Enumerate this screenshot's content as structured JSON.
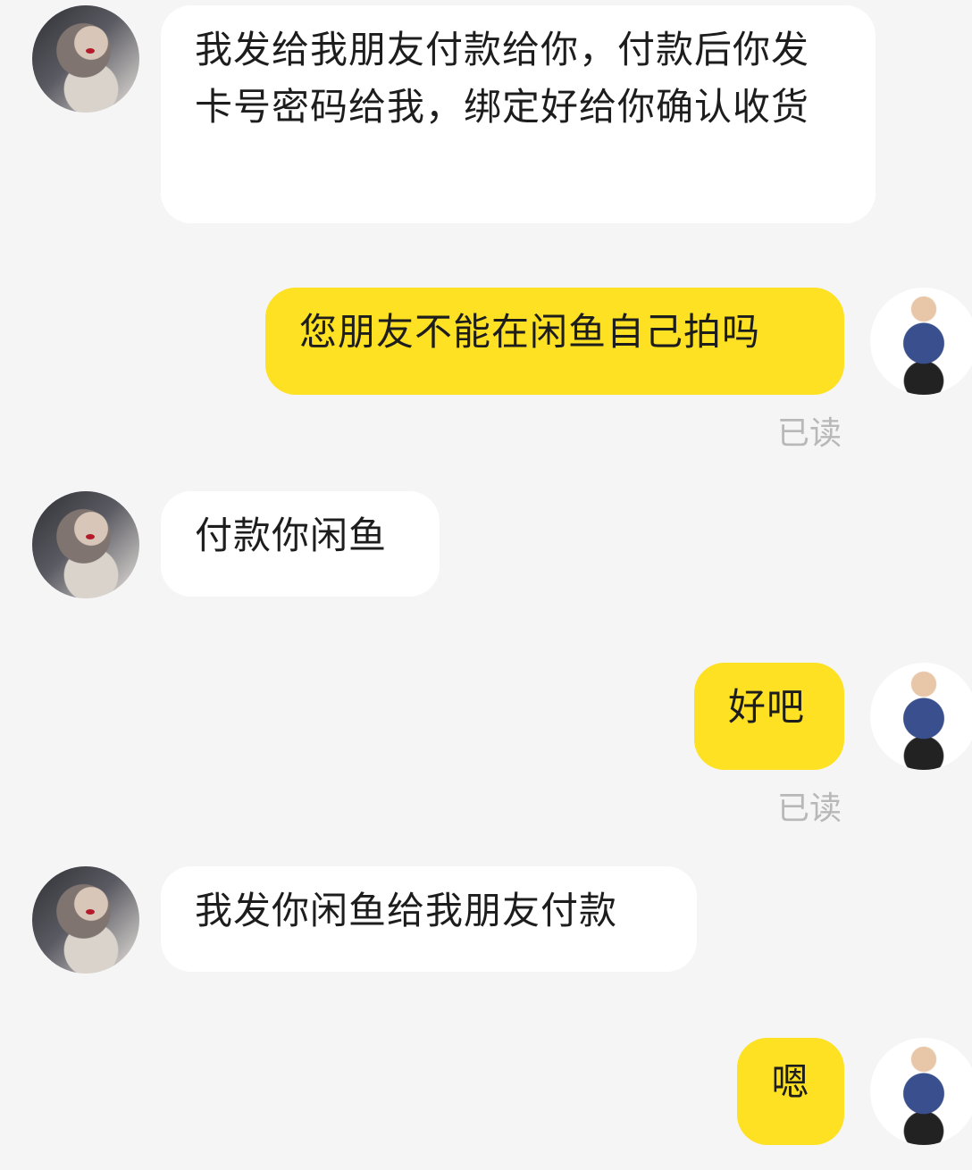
{
  "messages": [
    {
      "id": 1,
      "side": "left",
      "text": "我发给我朋友付款给你，付款后你发卡号密码给我，绑定好给你确认收货"
    },
    {
      "id": 2,
      "side": "right",
      "text": "您朋友不能在闲鱼自己拍吗",
      "status": "已读"
    },
    {
      "id": 3,
      "side": "left",
      "text": "付款你闲鱼"
    },
    {
      "id": 4,
      "side": "right",
      "text": "好吧",
      "status": "已读"
    },
    {
      "id": 5,
      "side": "left",
      "text": "我发你闲鱼给我朋友付款"
    },
    {
      "id": 6,
      "side": "right",
      "text": "嗯"
    }
  ],
  "colors": {
    "background": "#f5f5f5",
    "incoming_bubble": "#ffffff",
    "outgoing_bubble": "#fde122",
    "read_status": "#b8b8b8"
  }
}
